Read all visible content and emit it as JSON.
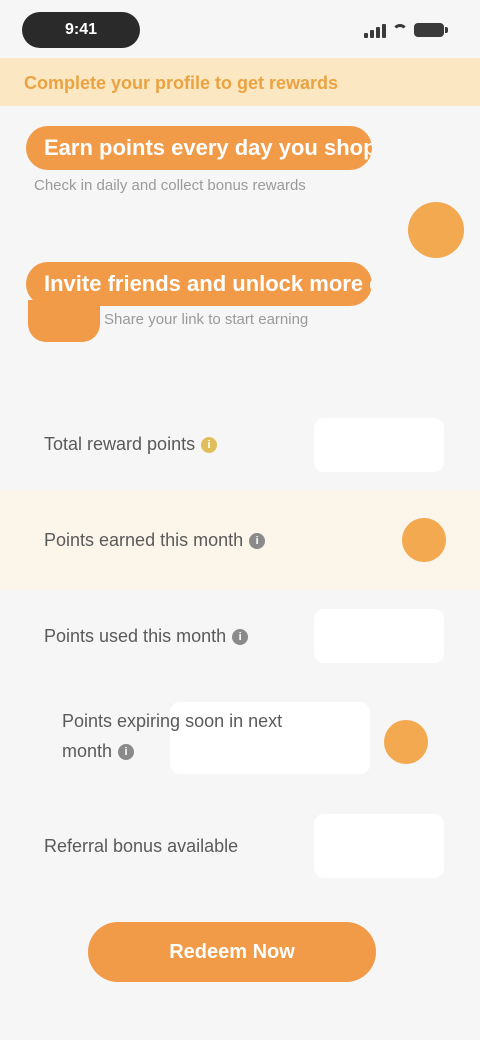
{
  "status_bar": {
    "time": "9:41",
    "icons": [
      "signal-icon",
      "wifi-icon",
      "battery-icon"
    ]
  },
  "notice": {
    "text": "Complete your profile to get rewards"
  },
  "hero": {
    "title_1": "Earn points every day you shop",
    "subtitle_1": "Check in daily and collect bonus rewards",
    "title_2": "Invite friends and unlock more gifts",
    "subtitle_2": "Share your link to start earning"
  },
  "list": {
    "items": [
      {
        "label": "Total reward points",
        "value": ""
      },
      {
        "label": "Points earned this month",
        "value": ""
      },
      {
        "label": "Points used this month",
        "value": ""
      },
      {
        "label": "Points expiring soon in next month",
        "value": ""
      },
      {
        "label": "Referral bonus available",
        "value": ""
      }
    ]
  },
  "actions": {
    "primary_label": "Redeem Now"
  },
  "colors": {
    "accent": "#f19a47",
    "accent_light": "#f2a950",
    "banner_bg": "#fbe7c2",
    "highlight_bg": "#fcf6ea",
    "background": "#f6f6f6"
  }
}
